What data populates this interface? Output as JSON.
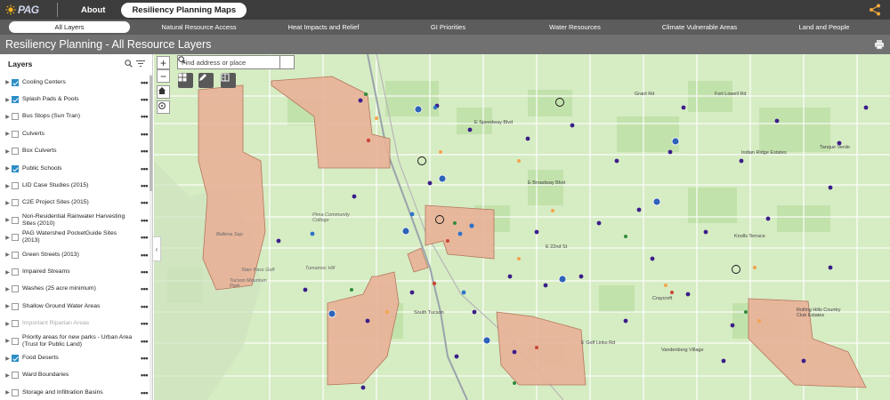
{
  "header": {
    "logo_text": "PAG",
    "nav": [
      {
        "label": "About",
        "active": false
      },
      {
        "label": "Resiliency Planning Maps",
        "active": true
      }
    ]
  },
  "tabs": [
    {
      "label": "All Layers",
      "active": true
    },
    {
      "label": "Natural Resource Access",
      "active": false
    },
    {
      "label": "Heat Impacts and Relief",
      "active": false
    },
    {
      "label": "GI Priorities",
      "active": false
    },
    {
      "label": "Water Resources",
      "active": false
    },
    {
      "label": "Climate Vulnerable Areas",
      "active": false
    },
    {
      "label": "Land and People",
      "active": false
    }
  ],
  "page_title": "Resiliency Planning - All Resource Layers",
  "layers_panel": {
    "title": "Layers",
    "items": [
      {
        "label": "Cooling Centers",
        "checked": true,
        "dim": false
      },
      {
        "label": "Splash Pads & Pools",
        "checked": true,
        "dim": false
      },
      {
        "label": "Bus Stops (Sun Tran)",
        "checked": false,
        "dim": false
      },
      {
        "label": "Culverts",
        "checked": false,
        "dim": false
      },
      {
        "label": "Box Culverts",
        "checked": false,
        "dim": false
      },
      {
        "label": "Public Schools",
        "checked": true,
        "dim": false
      },
      {
        "label": "LID Case Studies (2015)",
        "checked": false,
        "dim": false
      },
      {
        "label": "C2E Project Sites (2015)",
        "checked": false,
        "dim": false
      },
      {
        "label": "Non-Residential Rainwater Harvesting Sites (2010)",
        "checked": false,
        "dim": false
      },
      {
        "label": "PAG Watershed PocketGuide Sites (2013)",
        "checked": false,
        "dim": false
      },
      {
        "label": "Green Streets (2013)",
        "checked": false,
        "dim": false
      },
      {
        "label": "Impaired Streams",
        "checked": false,
        "dim": false
      },
      {
        "label": "Washes (25 acre minimum)",
        "checked": false,
        "dim": false
      },
      {
        "label": "Shallow Ground Water Areas",
        "checked": false,
        "dim": false
      },
      {
        "label": "Important Riparian Areas",
        "checked": false,
        "dim": true
      },
      {
        "label": "Priority areas for new parks - Urban Area (Trust for Public Land)",
        "checked": false,
        "dim": false
      },
      {
        "label": "Food Deserts",
        "checked": true,
        "dim": false
      },
      {
        "label": "Ward Boundaries",
        "checked": false,
        "dim": false
      },
      {
        "label": "Storage and Infiltration Basins",
        "checked": false,
        "dim": false
      }
    ]
  },
  "map": {
    "search_placeholder": "Find address or place",
    "labels": [
      "Tanque Verde",
      "Indian Ridge Estates",
      "Knolls Terrace",
      "Craycroft",
      "Rolling Hills Country Club Estates",
      "Vandenberg Village",
      "Pima Community College",
      "Tucson Mountain Park",
      "South Tucson",
      "Tumamoc Hill",
      "Starr Pass Golf",
      "Ballena Sap",
      "E Speedway Blvd",
      "E Broadway Blvd",
      "E 22nd St",
      "Grant Rd",
      "Fort Lowell Rd",
      "E Golf Links Rd"
    ]
  },
  "colors": {
    "food_desert_fill": "#e9b298",
    "map_base": "#d6ecc3",
    "school_dot": "#3b1e8a",
    "splash_dot": "#2d74c8",
    "accent_active": "#2d8dc6"
  }
}
